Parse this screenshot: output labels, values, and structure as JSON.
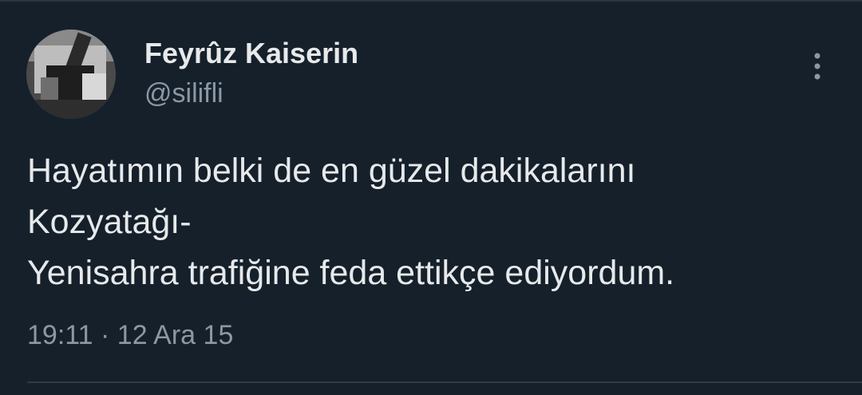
{
  "tweet": {
    "author": {
      "display_name": "Feyrûz Kaiserin",
      "handle": "@silifli",
      "avatar_icon": "avatar-photo"
    },
    "more_icon": "more-vertical-icon",
    "text_lines": [
      "Hayatımın belki de en güzel dakikalarını",
      "Kozyatağı-",
      "Yenisahra trafiğine feda ettikçe ediyordum."
    ],
    "time": "19:11",
    "separator": "·",
    "date": "12 Ara 15"
  },
  "colors": {
    "background": "#15202b",
    "primary_text": "#e7e9ea",
    "secondary_text": "#8b98a5",
    "divider": "#2f3a45"
  }
}
